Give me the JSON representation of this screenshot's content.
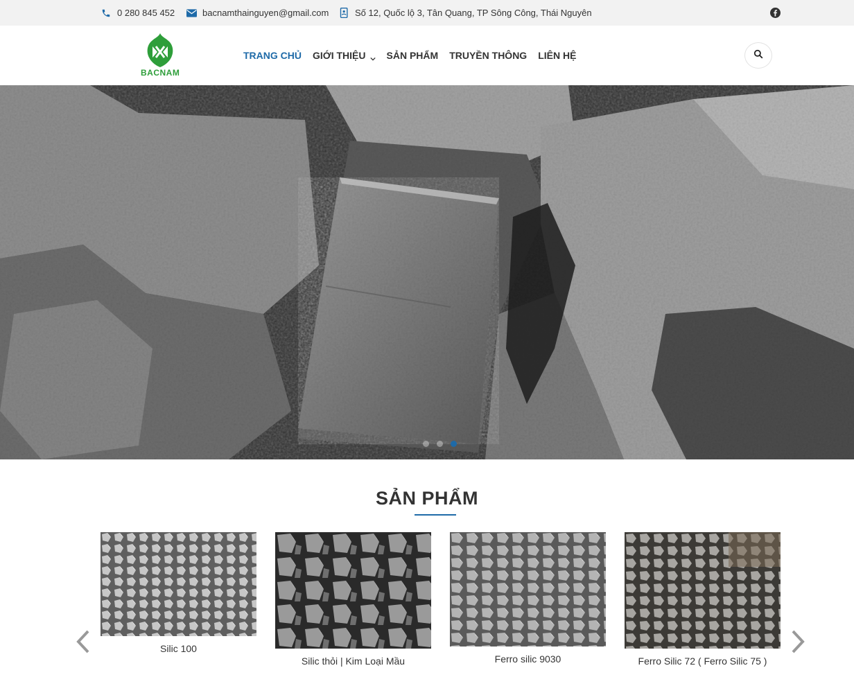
{
  "topbar": {
    "phone": "0 280 845 452",
    "email": "bacnamthainguyen@gmail.com",
    "address": "Số 12, Quốc lộ 3, Tân Quang, TP Sông Công, Thái Nguyên"
  },
  "brand": {
    "name": "BACNAM",
    "color": "#2e9e3a"
  },
  "nav": {
    "items": [
      {
        "label": "TRANG CHỦ",
        "active": true
      },
      {
        "label": "GIỚI THIỆU",
        "has_dropdown": true
      },
      {
        "label": "SẢN PHẨM"
      },
      {
        "label": "TRUYỀN THÔNG"
      },
      {
        "label": "LIÊN HỆ"
      }
    ],
    "accent_color": "#1e6aa8"
  },
  "hero": {
    "slide_count": 3,
    "active_slide": 3
  },
  "products": {
    "title": "SẢN PHẨM",
    "items": [
      {
        "name": "Silic 100"
      },
      {
        "name": "Silic thỏi | Kim Loại Mầu"
      },
      {
        "name": "Ferro silic 9030"
      },
      {
        "name": "Ferro Silic 72 ( Ferro Silic 75 )"
      }
    ]
  },
  "icons": [
    "phone-icon",
    "email-icon",
    "address-icon",
    "facebook-icon",
    "search-icon",
    "chevron-down-icon",
    "arrow-left-icon",
    "arrow-right-icon"
  ]
}
